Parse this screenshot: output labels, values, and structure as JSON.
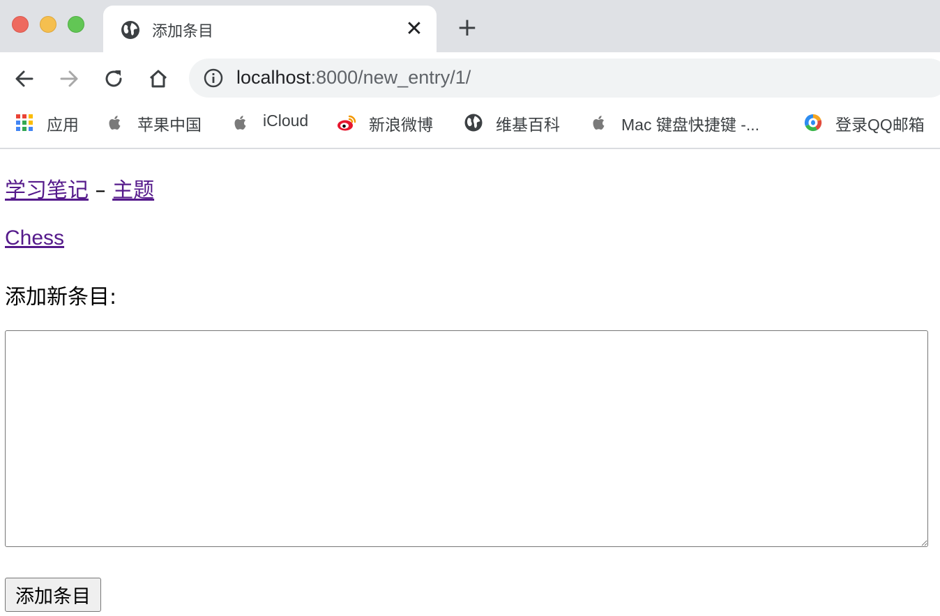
{
  "browser": {
    "tab": {
      "title": "添加条目"
    },
    "address_bar": {
      "host": "localhost",
      "path": ":8000/new_entry/1/"
    },
    "bookmarks": [
      {
        "label": "应用",
        "icon": "apps-grid-icon"
      },
      {
        "label": "苹果中国",
        "icon": "apple-icon"
      },
      {
        "label": "iCloud",
        "icon": "apple-icon"
      },
      {
        "label": "新浪微博",
        "icon": "weibo-icon"
      },
      {
        "label": "维基百科",
        "icon": "globe-icon"
      },
      {
        "label": "Mac 键盘快捷键 -...",
        "icon": "apple-icon"
      },
      {
        "label": "登录QQ邮箱",
        "icon": "qq-mail-icon"
      }
    ]
  },
  "page": {
    "breadcrumb": {
      "home": "学习笔记",
      "separator": "–",
      "topics": "主题"
    },
    "topic": "Chess",
    "heading": "添加新条目:",
    "textarea_value": "",
    "submit_label": "添加条目"
  },
  "colors": {
    "link": "#551a8b",
    "tabstrip": "#dfe1e5",
    "omnibox": "#f1f3f4"
  }
}
